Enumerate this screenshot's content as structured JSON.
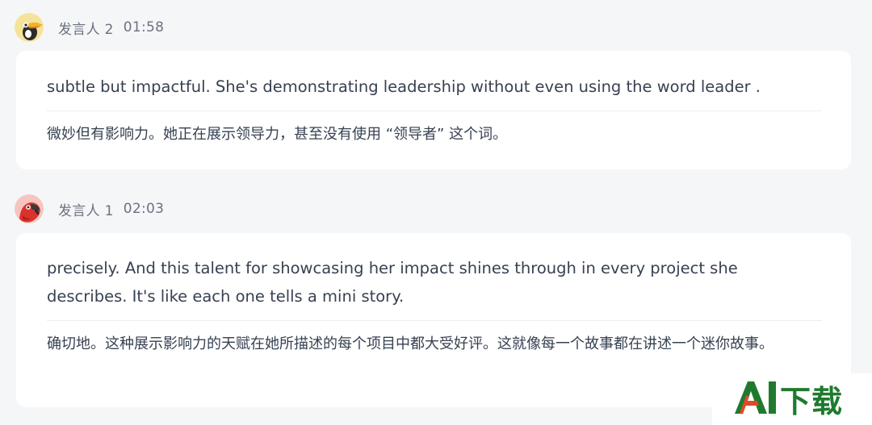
{
  "messages": [
    {
      "speaker": "发言人 2",
      "time": "01:58",
      "avatar_icon": "toucan-avatar-icon",
      "text_en": "subtle but impactful. She's demonstrating leadership without even using the word leader .",
      "text_zh": "微妙但有影响力。她正在展示领导力，甚至没有使用 “领导者” 这个词。"
    },
    {
      "speaker": "发言人 1",
      "time": "02:03",
      "avatar_icon": "parrot-avatar-icon",
      "text_en": "precisely. And this talent for showcasing her impact shines through in every project she describes. It's like each one tells a mini story.",
      "text_zh": "确切地。这种展示影响力的天赋在她所描述的每个项目中都大受好评。这就像每一个故事都在讲述一个迷你故事。"
    }
  ],
  "watermark": {
    "text": "AI下载",
    "icon": "ai-logo-icon"
  },
  "colors": {
    "background": "#f5f6f8",
    "card": "#ffffff",
    "text": "#374151",
    "meta": "#6b7280",
    "watermark_text": "#1f7a2e",
    "watermark_accent": "#e0492b"
  }
}
